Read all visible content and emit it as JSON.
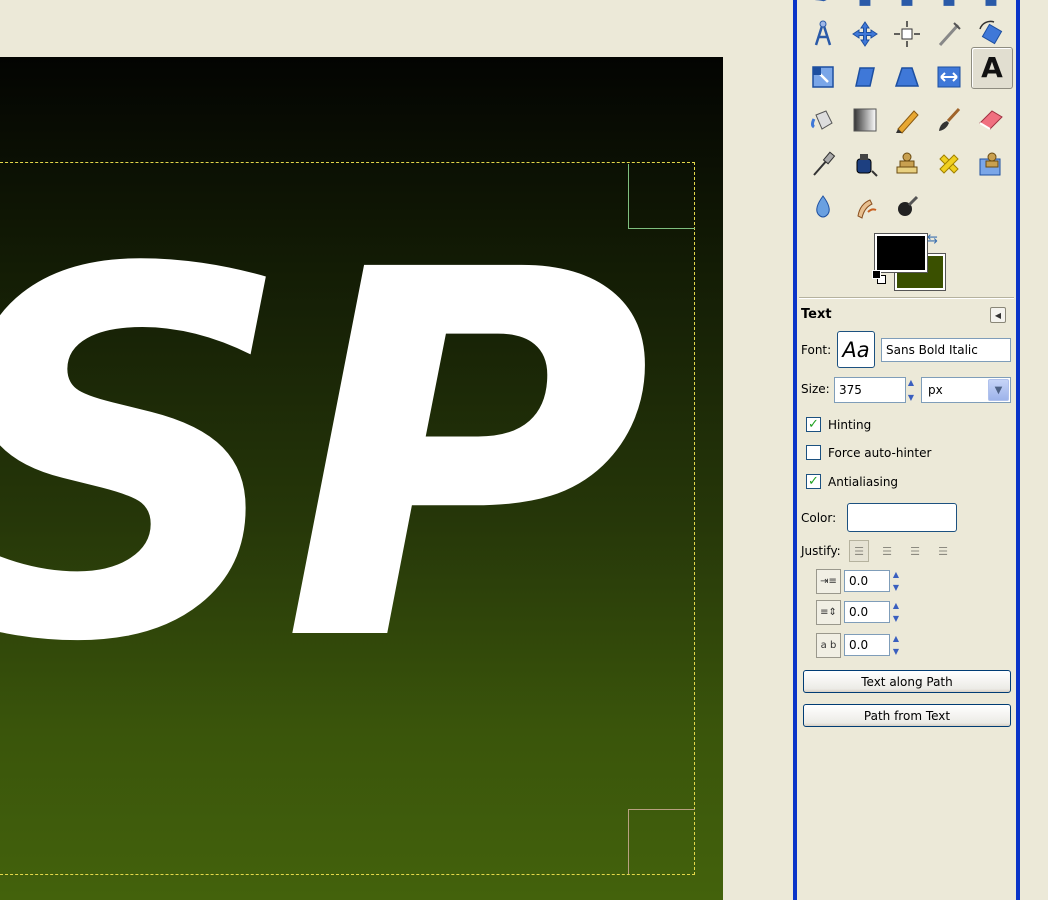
{
  "canvas": {
    "text_layer": "SP"
  },
  "toolbox": {
    "tools": [
      {
        "name": "paths-tool",
        "glyph": "✒"
      },
      {
        "name": "move-tool",
        "glyph": "✥"
      },
      {
        "name": "align-tool",
        "glyph": "⊹"
      },
      {
        "name": "crop-tool",
        "glyph": "✂"
      },
      {
        "name": "rotate-tool",
        "glyph": "⟳"
      },
      {
        "name": "scale-tool",
        "glyph": "⤡"
      },
      {
        "name": "shear-tool",
        "glyph": "▱"
      },
      {
        "name": "perspective-tool",
        "glyph": "⏢"
      },
      {
        "name": "flip-tool",
        "glyph": "⇔"
      },
      {
        "name": "text-tool",
        "glyph": "A"
      },
      {
        "name": "bucket-fill-tool",
        "glyph": "⛽"
      },
      {
        "name": "blend-tool",
        "glyph": "▦"
      },
      {
        "name": "pencil-tool",
        "glyph": "✏"
      },
      {
        "name": "paintbrush-tool",
        "glyph": "🖌"
      },
      {
        "name": "eraser-tool",
        "glyph": "▭"
      },
      {
        "name": "airbrush-tool",
        "glyph": "✎"
      },
      {
        "name": "ink-tool",
        "glyph": "✑"
      },
      {
        "name": "clone-tool",
        "glyph": "⚲"
      },
      {
        "name": "heal-tool",
        "glyph": "✚"
      },
      {
        "name": "perspective-clone-tool",
        "glyph": "⚲"
      },
      {
        "name": "blur-tool",
        "glyph": "💧"
      },
      {
        "name": "smudge-tool",
        "glyph": "☝"
      },
      {
        "name": "dodge-burn-tool",
        "glyph": "●"
      }
    ],
    "colors": {
      "foreground": "#000000",
      "background": "#3a5000"
    }
  },
  "tool_options": {
    "title": "Text",
    "font_label": "Font:",
    "font_preview": "Aa",
    "font_value": "Sans Bold Italic",
    "size_label": "Size:",
    "size_value": "375",
    "size_unit": "px",
    "hinting_label": "Hinting",
    "hinting_checked": true,
    "force_autohinter_label": "Force auto-hinter",
    "force_autohinter_checked": false,
    "antialiasing_label": "Antialiasing",
    "antialiasing_checked": true,
    "color_label": "Color:",
    "text_color": "#ffffff",
    "justify_label": "Justify:",
    "indent_value": "0.0",
    "line_spacing_value": "0.0",
    "letter_spacing_value": "0.0",
    "text_along_path_label": "Text along Path",
    "path_from_text_label": "Path from Text"
  }
}
